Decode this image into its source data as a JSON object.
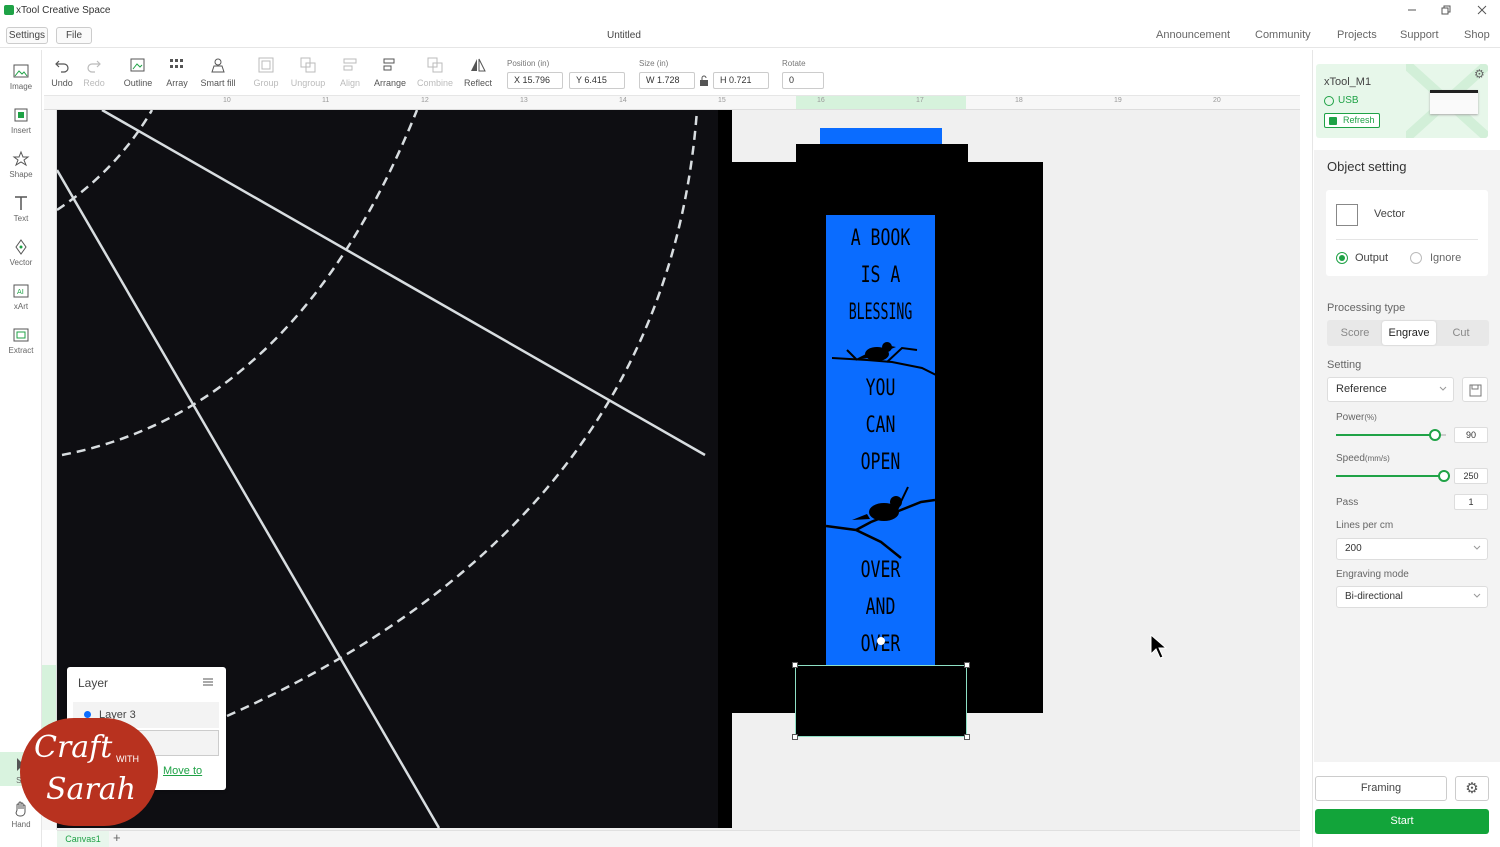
{
  "app": {
    "title": "xTool Creative Space",
    "doc_title": "Untitled"
  },
  "menu": {
    "settings": "Settings",
    "file": "File"
  },
  "nav": [
    "Announcement",
    "Community",
    "Projects",
    "Support",
    "Shop"
  ],
  "toolbar": {
    "undo": "Undo",
    "redo": "Redo",
    "outline": "Outline",
    "array": "Array",
    "smart_fill": "Smart fill",
    "group": "Group",
    "ungroup": "Ungroup",
    "align": "Align",
    "arrange": "Arrange",
    "combine": "Combine",
    "reflect": "Reflect",
    "position_label": "Position (in)",
    "pos_x": "X 15.796",
    "pos_y": "Y 6.415",
    "size_label": "Size (in)",
    "size_w": "W 1.728",
    "size_h": "H 0.721",
    "rotate_label": "Rotate",
    "rotate_value": "0"
  },
  "left_tools": [
    "Image",
    "Insert",
    "Shape",
    "Text",
    "Vector",
    "xArt",
    "Extract"
  ],
  "bottom_tools": {
    "select": "Se",
    "hand": "Hand"
  },
  "ruler_ticks": [
    "10",
    "11",
    "12",
    "13",
    "14",
    "15",
    "16",
    "17",
    "18",
    "19",
    "20"
  ],
  "design": {
    "lines": [
      "A BOOK",
      "IS A",
      "BLESSING",
      "YOU",
      "CAN",
      "OPEN",
      "OVER",
      "AND",
      "OVER"
    ],
    "blue": "#0a6cff"
  },
  "layer_panel": {
    "title": "Layer",
    "layer_name": "Layer 3",
    "move_to": "Move to"
  },
  "watermark": {
    "line1": "Craft",
    "with": "WITH",
    "line2": "Sarah",
    "color": "#b8321f"
  },
  "canvas_tab": "Canvas1",
  "device": {
    "name": "xTool_M1",
    "connection": "USB",
    "refresh": "Refresh"
  },
  "object_setting": {
    "title": "Object setting",
    "type": "Vector",
    "output": "Output",
    "ignore": "Ignore",
    "processing_type_label": "Processing type",
    "processing_types": [
      "Score",
      "Engrave",
      "Cut"
    ],
    "active_processing": "Engrave",
    "setting_label": "Setting",
    "setting_value": "Reference",
    "power_label": "Power",
    "power_unit": "(%)",
    "power_value": "90",
    "power_fraction": 0.9,
    "speed_label": "Speed",
    "speed_unit": "(mm/s)",
    "speed_value": "250",
    "speed_fraction": 1.0,
    "pass_label": "Pass",
    "pass_value": "1",
    "lpc_label": "Lines per cm",
    "lpc_value": "200",
    "mode_label": "Engraving mode",
    "mode_value": "Bi-directional"
  },
  "actions": {
    "framing": "Framing",
    "start": "Start"
  },
  "colors": {
    "accent": "#1fa246",
    "start_bg": "#12a43a"
  }
}
